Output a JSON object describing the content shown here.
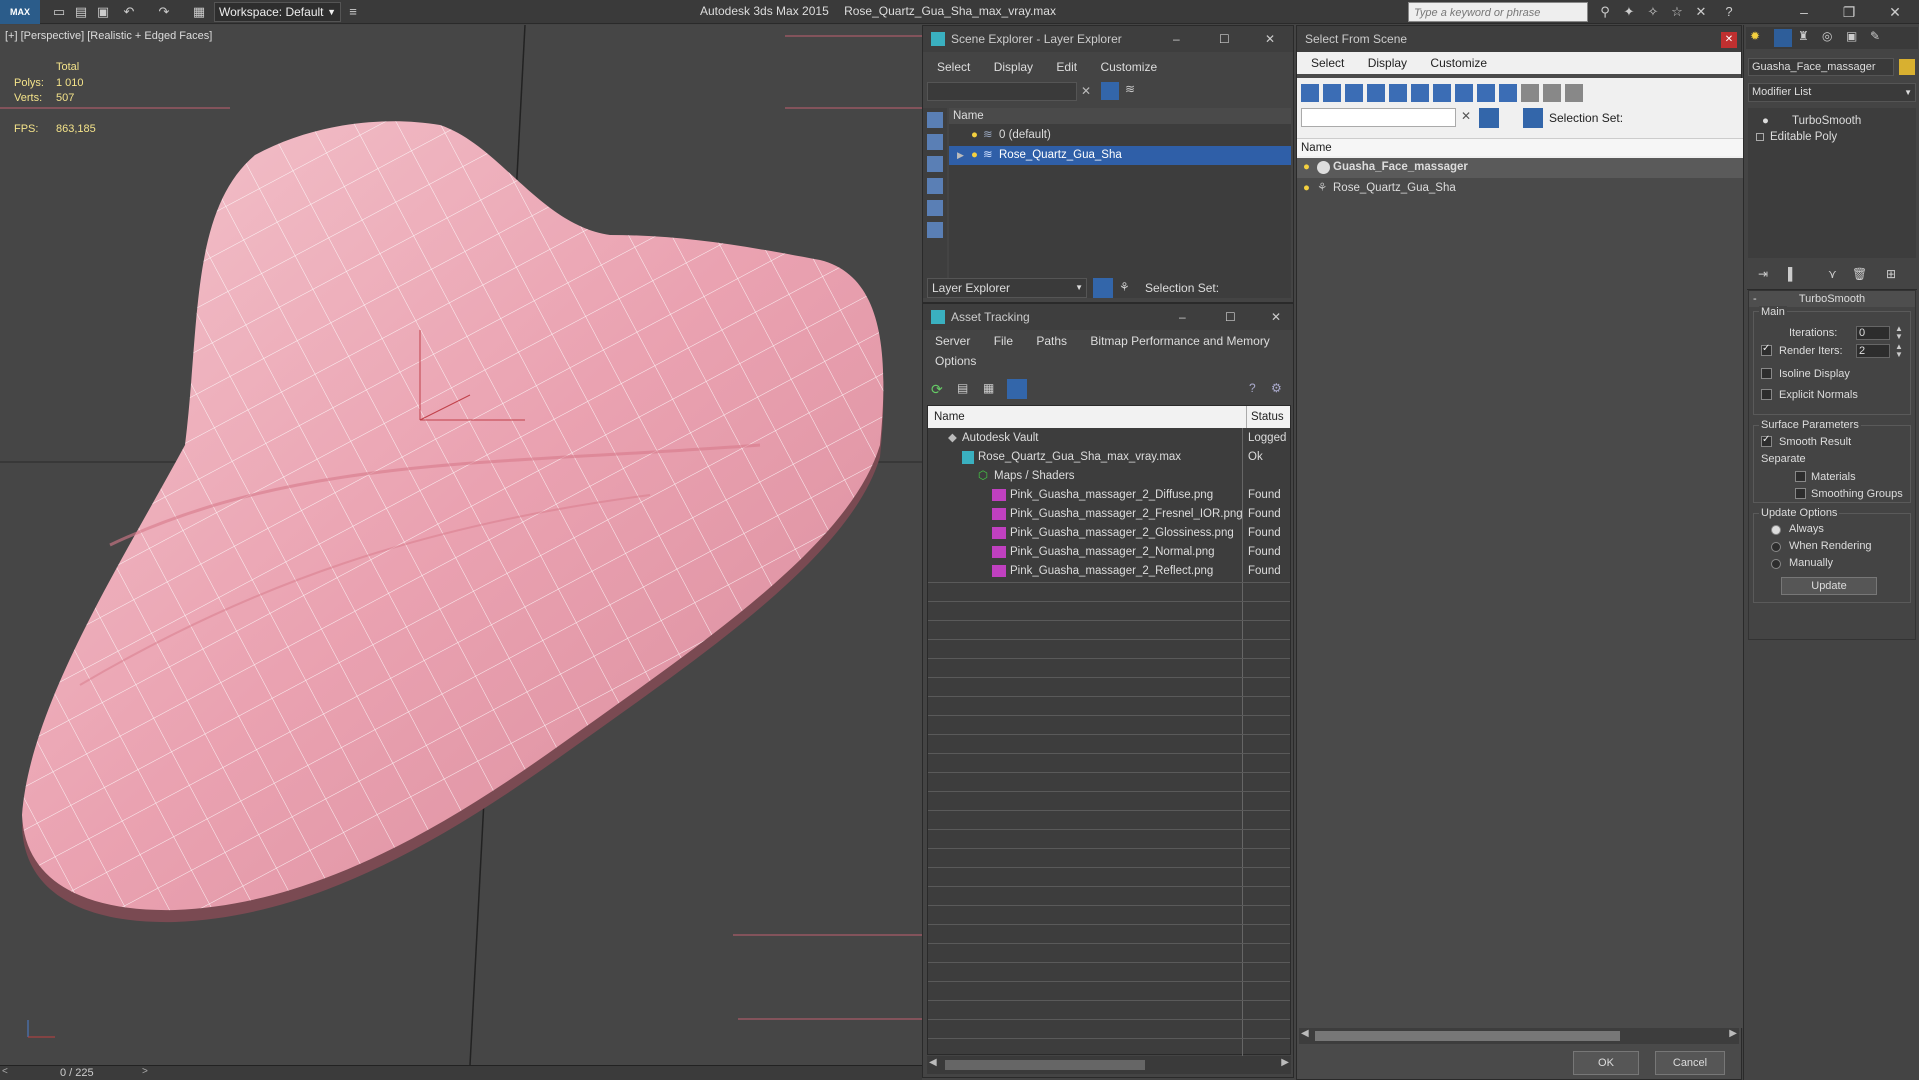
{
  "titlebar": {
    "workspace": "Workspace: Default",
    "app_title": "Autodesk 3ds Max  2015",
    "file_title": "Rose_Quartz_Gua_Sha_max_vray.max",
    "search_placeholder": "Type a keyword or phrase"
  },
  "viewport": {
    "label": "[+] [Perspective] [Realistic + Edged Faces]",
    "total_label": "Total",
    "polys_label": "Polys:",
    "polys_value": "1 010",
    "verts_label": "Verts:",
    "verts_value": "507",
    "fps_label": "FPS:",
    "fps_value": "863,185",
    "time": "0 / 225"
  },
  "scene_explorer": {
    "title": "Scene Explorer - Layer Explorer",
    "menu": [
      "Select",
      "Display",
      "Edit",
      "Customize"
    ],
    "col_name": "Name",
    "rows": [
      "0 (default)",
      "Rose_Quartz_Gua_Sha"
    ],
    "footer_label": "Layer Explorer",
    "selection_set": "Selection Set:"
  },
  "asset_tracking": {
    "title": "Asset Tracking",
    "menu": [
      "Server",
      "File",
      "Paths",
      "Bitmap Performance and Memory"
    ],
    "menu2": "Options",
    "col_name": "Name",
    "col_status": "Status",
    "rows": [
      {
        "name": "Autodesk Vault",
        "status": "Logged"
      },
      {
        "name": "Rose_Quartz_Gua_Sha_max_vray.max",
        "status": "Ok"
      },
      {
        "name": "Maps / Shaders",
        "status": ""
      },
      {
        "name": "Pink_Guasha_massager_2_Diffuse.png",
        "status": "Found"
      },
      {
        "name": "Pink_Guasha_massager_2_Fresnel_IOR.png",
        "status": "Found"
      },
      {
        "name": "Pink_Guasha_massager_2_Glossiness.png",
        "status": "Found"
      },
      {
        "name": "Pink_Guasha_massager_2_Normal.png",
        "status": "Found"
      },
      {
        "name": "Pink_Guasha_massager_2_Reflect.png",
        "status": "Found"
      }
    ]
  },
  "select_from_scene": {
    "title": "Select From Scene",
    "menu": [
      "Select",
      "Display",
      "Customize"
    ],
    "selection_set": "Selection Set:",
    "col_name": "Name",
    "rows": [
      "Guasha_Face_massager",
      "Rose_Quartz_Gua_Sha"
    ],
    "ok": "OK",
    "cancel": "Cancel"
  },
  "command_panel": {
    "object_name": "Guasha_Face_massager",
    "modifier_list": "Modifier List",
    "stack": [
      "TurboSmooth",
      "Editable Poly"
    ],
    "rollout_title": "TurboSmooth",
    "main_group": "Main",
    "iterations_label": "Iterations:",
    "iterations_value": "0",
    "render_iters_label": "Render Iters:",
    "render_iters_value": "2",
    "isoline": "Isoline Display",
    "explicit_normals": "Explicit Normals",
    "surface_group": "Surface Parameters",
    "smooth_result": "Smooth Result",
    "separate": "Separate",
    "materials": "Materials",
    "smoothing_groups": "Smoothing Groups",
    "update_group": "Update Options",
    "always": "Always",
    "when_rendering": "When Rendering",
    "manually": "Manually",
    "update_button": "Update"
  },
  "colors": {
    "selection": "#2f5fa8",
    "stone": "#e9a7b3",
    "stats": "#f4e38a"
  }
}
